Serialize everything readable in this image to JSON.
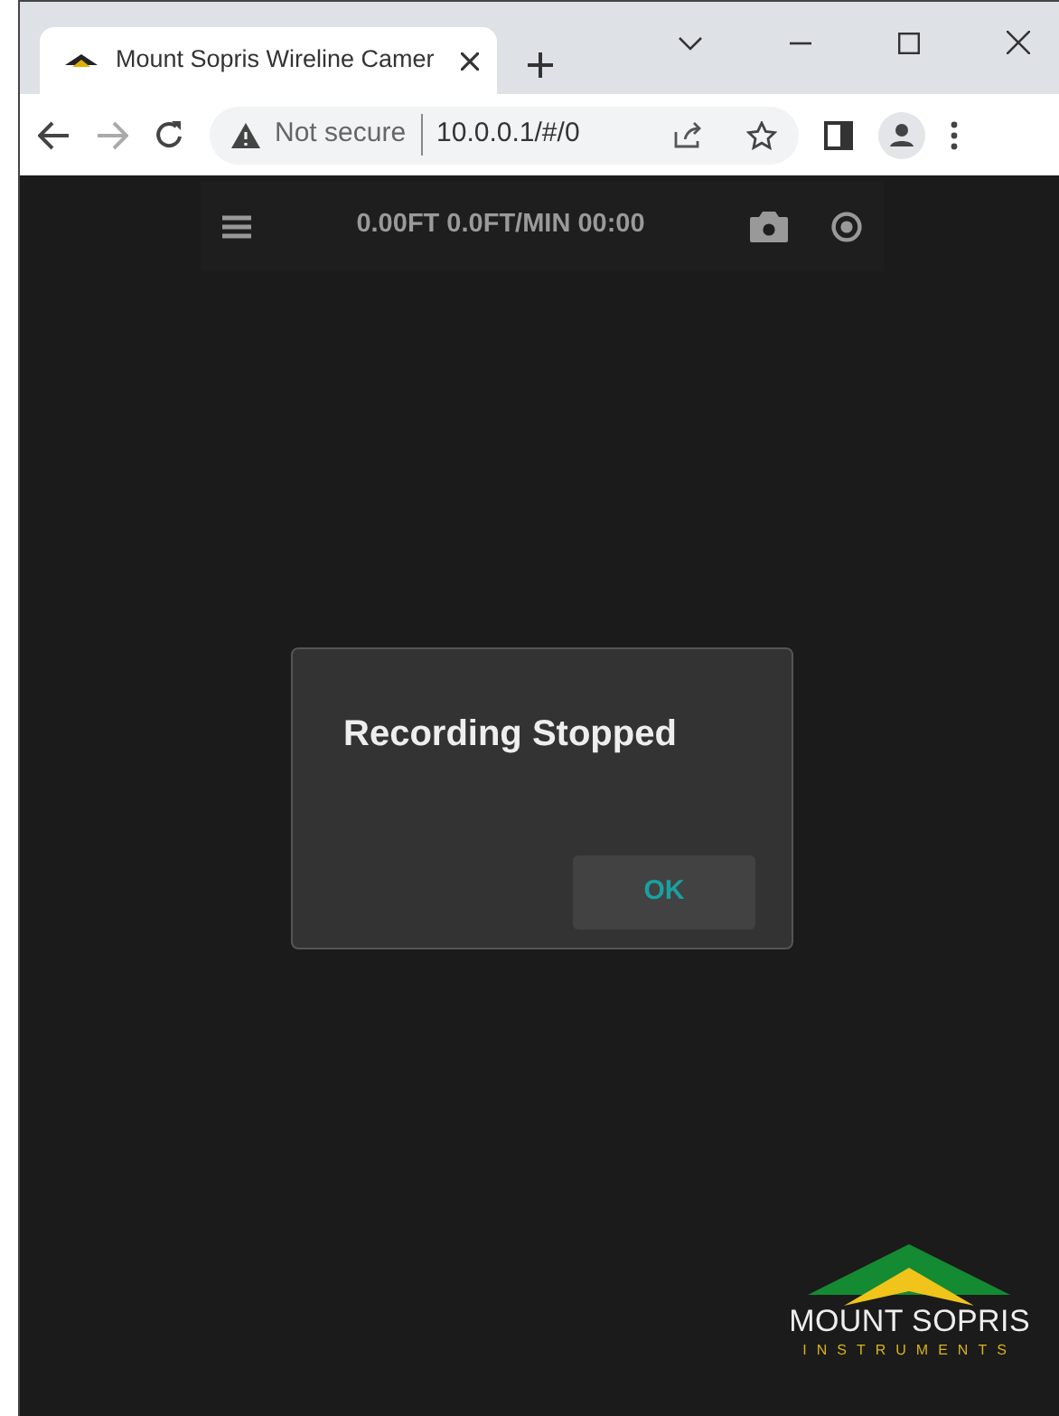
{
  "browser": {
    "tabs": [
      {
        "title": "Mount Sopris Wireline Camer",
        "selected": true
      }
    ],
    "address": {
      "security": "Not secure",
      "url": "10.0.0.1/#/0"
    }
  },
  "toolbar": {
    "readout": "0.00FT 0.0FT/MIN 00:00"
  },
  "dialog": {
    "title": "Recording Stopped",
    "button": "OK"
  },
  "logo": {
    "name": "MOUNT SOPRIS",
    "tagline": "INSTRUMENTS"
  }
}
